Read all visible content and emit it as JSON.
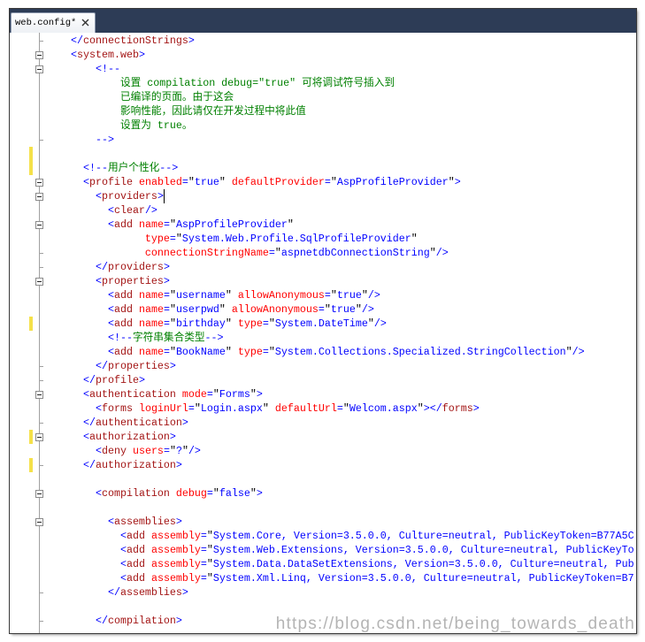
{
  "window": {
    "tab_title": "web.config*"
  },
  "icons": {
    "tab_close": "close-icon",
    "outline_toggle": "minus-box-icon"
  },
  "editor": {
    "lines": [
      "    </connectionStrings>",
      "    <system.web>",
      "        <!--",
      "            设置 compilation debug=\"true\" 可将调试符号插入到",
      "            已编译的页面。由于这会",
      "            影响性能，因此请仅在开发过程中将此值",
      "            设置为 true。",
      "        -->",
      "",
      "      <!--用户个性化-->",
      "      <profile enabled=\"true\" defaultProvider=\"AspProfileProvider\">",
      "        <providers>",
      "          <clear/>",
      "          <add name=\"AspProfileProvider\"",
      "                type=\"System.Web.Profile.SqlProfileProvider\"",
      "                connectionStringName=\"aspnetdbConnectionString\"/>",
      "        </providers>",
      "        <properties>",
      "          <add name=\"username\" allowAnonymous=\"true\"/>",
      "          <add name=\"userpwd\" allowAnonymous=\"true\"/>",
      "          <add name=\"birthday\" type=\"System.DateTime\"/>",
      "          <!--字符串集合类型-->",
      "          <add name=\"BookName\" type=\"System.Collections.Specialized.StringCollection\"/>",
      "        </properties>",
      "      </profile>",
      "      <authentication mode=\"Forms\">",
      "        <forms loginUrl=\"Login.aspx\" defaultUrl=\"Welcom.aspx\"></forms>",
      "      </authentication>",
      "      <authorization>",
      "        <deny users=\"?\"/>",
      "      </authorization>",
      "",
      "        <compilation debug=\"false\">",
      "",
      "          <assemblies>",
      "            <add assembly=\"System.Core, Version=3.5.0.0, Culture=neutral, PublicKeyToken=B77A5C",
      "            <add assembly=\"System.Web.Extensions, Version=3.5.0.0, Culture=neutral, PublicKeyTo",
      "            <add assembly=\"System.Data.DataSetExtensions, Version=3.5.0.0, Culture=neutral, Pub",
      "            <add assembly=\"System.Xml.Linq, Version=3.5.0.0, Culture=neutral, PublicKeyToken=B7",
      "          </assemblies>",
      "",
      "        </compilation>"
    ],
    "outlining": {
      "collapsible_lines": [
        1,
        2,
        10,
        11,
        13,
        17,
        25,
        28,
        32,
        34
      ],
      "region_end_lines": [
        0,
        7,
        15,
        16,
        23,
        24,
        27,
        30,
        39,
        41
      ]
    },
    "changed_lines": [
      8,
      9,
      20,
      28,
      30
    ],
    "cursor": {
      "line": 11,
      "column": 19
    }
  },
  "colors": {
    "tab_well": "#2D3C56",
    "tab_background": "#FFFFFF",
    "editor_background": "#FFFFFF",
    "xml_delimiter": "#0000FF",
    "xml_element_name": "#A31515",
    "xml_attribute_name": "#FF0000",
    "xml_attribute_value": "#0000FF",
    "xml_quote": "#000000",
    "xml_comment": "#008000",
    "xml_text": "#000000",
    "change_marker": "#F5E14A",
    "outline_line": "#A0A0A0",
    "watermark": "#B4B4B4"
  },
  "watermark": "https://blog.csdn.net/being_towards_death"
}
